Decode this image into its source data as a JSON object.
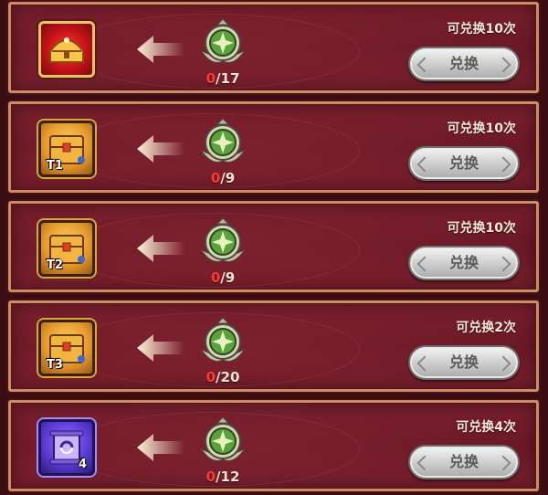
{
  "exchange_list": [
    {
      "item_icon": "red-treasure-chest-icon",
      "item_badge": "",
      "currency_icon": "green-medal-icon",
      "owned": "0",
      "required": "/17",
      "limit_text": "可兑换10次",
      "button_label": "兑换"
    },
    {
      "item_icon": "gold-treasure-chest-icon",
      "item_badge": "T1",
      "currency_icon": "green-medal-icon",
      "owned": "0",
      "required": "/9",
      "limit_text": "可兑换10次",
      "button_label": "兑换"
    },
    {
      "item_icon": "gold-treasure-chest-icon",
      "item_badge": "T2",
      "currency_icon": "green-medal-icon",
      "owned": "0",
      "required": "/9",
      "limit_text": "可兑换10次",
      "button_label": "兑换"
    },
    {
      "item_icon": "gold-treasure-chest-icon",
      "item_badge": "T3",
      "currency_icon": "green-medal-icon",
      "owned": "0",
      "required": "/20",
      "limit_text": "可兑换2次",
      "button_label": "兑换"
    },
    {
      "item_icon": "purple-scroll-icon",
      "item_badge": "4",
      "currency_icon": "green-medal-icon",
      "owned": "0",
      "required": "/12",
      "limit_text": "可兑换4次",
      "button_label": "兑换"
    }
  ],
  "colors": {
    "row_background": "#6a1826",
    "row_border": "#c98e62",
    "owned_count": "#ff3a30",
    "button_fill": "#cfcfcf"
  }
}
